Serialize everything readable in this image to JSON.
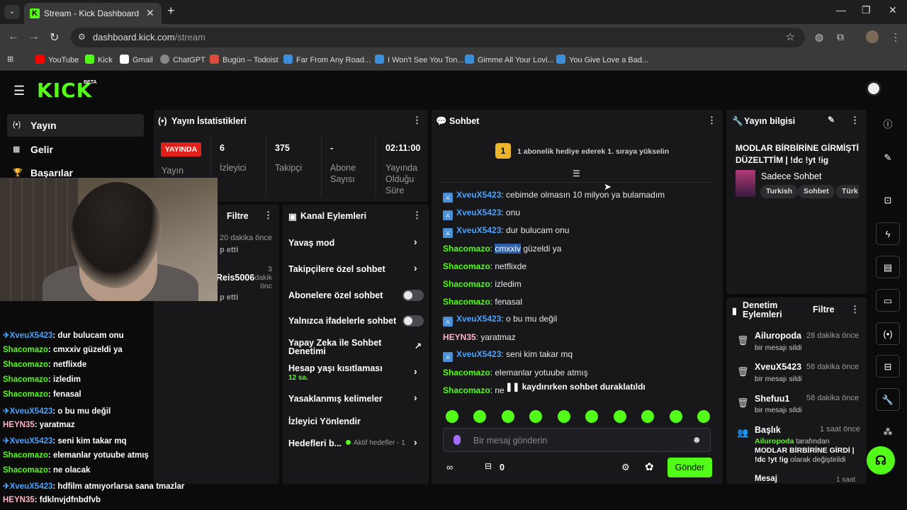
{
  "browser": {
    "tab_title": "Stream - Kick Dashboard",
    "url_host": "dashboard.kick.com",
    "url_path": "/stream",
    "bookmarks": [
      "YouTube",
      "Kick",
      "Gmail",
      "ChatGPT",
      "Bugün – Todoist",
      "Far From Any Road...",
      "I Won't See You Ton...",
      "Gimme All Your Lovi...",
      "You Give Love a Bad..."
    ]
  },
  "brand": {
    "logo": "KICK",
    "badge": "BETA",
    "accent": "#53fc18"
  },
  "sidebar": {
    "items": [
      {
        "label": "Yayın",
        "icon": "broadcast-icon"
      },
      {
        "label": "Gelir",
        "icon": "chart-icon"
      },
      {
        "label": "Başarılar",
        "icon": "trophy-icon"
      }
    ]
  },
  "stats": {
    "title": "Yayın İstatistikleri",
    "status": "YAYINDA",
    "status_label": "Yayın",
    "viewers": "6",
    "viewers_label": "İzleyici",
    "followers": "375",
    "followers_label": "Takipçi",
    "subs": "-",
    "subs_label": "Abone Sayısı",
    "uptime": "02:11:00",
    "uptime_label": "Yayında Olduğu Süre"
  },
  "events": {
    "filter": "Filtre",
    "items": [
      {
        "time": "20 dakika önce",
        "text": "p etti"
      },
      {
        "name": "Reis5006",
        "time": "3 dakik önc",
        "text": "p etti"
      }
    ]
  },
  "channel_actions": {
    "title": "Kanal Eylemleri",
    "items": [
      {
        "label": "Yavaş mod",
        "type": "chevron"
      },
      {
        "label": "Takipçilere özel sohbet",
        "type": "chevron"
      },
      {
        "label": "Abonelere özel sohbet",
        "type": "toggle"
      },
      {
        "label": "Yalnızca ifadelerle sohbet",
        "type": "toggle"
      },
      {
        "label": "Yapay Zeka ile Sohbet Denetimi",
        "type": "external"
      },
      {
        "label": "Hesap yaşı kısıtlaması",
        "sub": "12 sa.",
        "type": "chevron"
      },
      {
        "label": "Yasaklanmış kelimeler",
        "type": "chevron"
      },
      {
        "label": "İzleyici Yönlendir",
        "type": "none"
      },
      {
        "label": "Hedefleri b...",
        "sub": "Aktif hedefler - 1",
        "type": "chevron"
      }
    ]
  },
  "chat": {
    "title": "Sohbet",
    "gift_notice": "1 abonelik hediye ederek 1. sıraya yükselin",
    "gift_rank": "1",
    "messages": [
      {
        "user": "XveuX5423",
        "text": ": cebimde olmasın 10 milyon ya bulamadım",
        "badge": true
      },
      {
        "user": "XveuX5423",
        "text": ": onu",
        "badge": true
      },
      {
        "user": "XveuX5423",
        "text": ": dur bulucam onu",
        "badge": true
      },
      {
        "user": "Shacomazo",
        "text_pre": ": ",
        "highlight": "cmxxiv",
        "text": " güzeldi ya",
        "badge": false
      },
      {
        "user": "Shacomazo",
        "text": ": netflixde",
        "badge": false
      },
      {
        "user": "Shacomazo",
        "text": ": izledim",
        "badge": false
      },
      {
        "user": "Shacomazo",
        "text": ": fenasal",
        "badge": false
      },
      {
        "user": "XveuX5423",
        "text": ": o bu mu değil",
        "badge": true
      },
      {
        "user": "HEYN35",
        "text": ": yaratmaz",
        "badge": false
      },
      {
        "user": "XveuX5423",
        "text": ": seni kim takar mq",
        "badge": true
      },
      {
        "user": "Shacomazo",
        "text": ": elemanlar yotuube atmış",
        "badge": false
      },
      {
        "user": "Shacomazo",
        "text": ": ne o",
        "badge": false
      }
    ],
    "paused": "kaydırırken sohbet duraklatıldı",
    "placeholder": "Bir mesaj gönderin",
    "points": "0",
    "send": "Gönder"
  },
  "overlay_chat": [
    {
      "user": "XveuX5423",
      "text": ": dur bulucam onu",
      "badge": true
    },
    {
      "user": "Shacomazo",
      "text": ": cmxxiv güzeldi ya"
    },
    {
      "user": "Shacomazo",
      "text": ": netflixde"
    },
    {
      "user": "Shacomazo",
      "text": ": izledim"
    },
    {
      "user": "Shacomazo",
      "text": ": fenasal"
    },
    {
      "user": "XveuX5423",
      "text": ": o bu mu değil",
      "badge": true
    },
    {
      "user": "HEYN35",
      "text": ": yaratmaz"
    },
    {
      "user": "XveuX5423",
      "text": ": seni kim takar mq",
      "badge": true
    },
    {
      "user": "Shacomazo",
      "text": ": elemanlar yotuube atmış"
    },
    {
      "user": "Shacomazo",
      "text": ": ne olacak"
    },
    {
      "user": "XveuX5423",
      "text": ": hdfilm atmıyorlarsa sana tmazlar",
      "badge": true
    },
    {
      "user": "HEYN35",
      "text": ": fdklnvjdfnbdfvb"
    }
  ],
  "colors": {
    "xveux": "#4aa3ff",
    "shacomazo": "#53fc18",
    "heyn35": "#ffb3c6"
  },
  "stream_info": {
    "title": "Yayın bilgisi",
    "stream_title": "MODLAR BİRBİRİNE GİRMİŞTİ DÜZELTTİM | !dc !yt !ig",
    "category": "Sadece Sohbet",
    "tags": [
      "Turkish",
      "Sohbet",
      "Türk"
    ]
  },
  "moderation": {
    "title": "Denetim Eylemleri",
    "filter": "Filtre",
    "items": [
      {
        "user": "Ailuropoda",
        "time": "28 dakika önce",
        "desc": "bir mesajı sildi"
      },
      {
        "user": "XveuX5423",
        "time": "58 dakika önce",
        "desc": "bir mesajı sildi"
      },
      {
        "user": "Shefuu1",
        "time": "58 dakika önce",
        "desc": "bir mesajı sildi"
      }
    ],
    "title_change": {
      "label": "Başlık",
      "time": "1 saat önce",
      "by": "Ailuropoda",
      "by_suffix": " tarafından",
      "new_title": "MODLAR BİRBİRİNE GİRDİ | !dc !yt !ig",
      "suffix": " olarak değiştirildi"
    },
    "next_partial": "Mesaj Sabitlenmesi",
    "next_time": "1 saat"
  }
}
